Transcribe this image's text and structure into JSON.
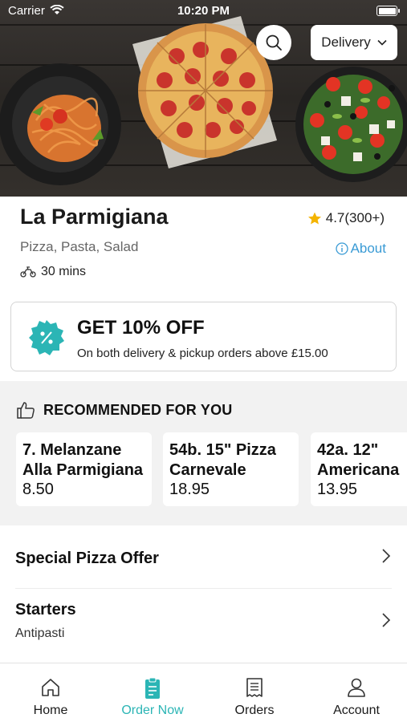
{
  "status_bar": {
    "carrier": "Carrier",
    "time": "10:20 PM"
  },
  "header": {
    "delivery_mode": "Delivery"
  },
  "restaurant": {
    "name": "La Parmigiana",
    "rating": "4.7(300+)",
    "cuisines": "Pizza, Pasta, Salad",
    "about_label": "About",
    "delivery_time": "30 mins"
  },
  "promo": {
    "title": "GET 10% OFF",
    "subtitle": "On both delivery & pickup orders above £15.00"
  },
  "recommended": {
    "heading": "RECOMMENDED FOR YOU",
    "items": [
      {
        "name": "7. Melanzane\nAlla Parmigiana",
        "price": "8.50"
      },
      {
        "name": "54b. 15\" Pizza\nCarnevale",
        "price": "18.95"
      },
      {
        "name": "42a. 12\"\nAmericana",
        "price": "13.95"
      }
    ]
  },
  "menu": [
    {
      "title": "Special Pizza Offer",
      "subtitle": ""
    },
    {
      "title": "Starters",
      "subtitle": "Antipasti"
    }
  ],
  "tabs": [
    {
      "label": "Home",
      "icon": "home-icon"
    },
    {
      "label": "Order Now",
      "icon": "order-icon"
    },
    {
      "label": "Orders",
      "icon": "receipt-icon"
    },
    {
      "label": "Account",
      "icon": "user-icon"
    }
  ],
  "colors": {
    "accent": "#2bb5b5",
    "link": "#3a9bd5",
    "star": "#f4b400",
    "promo_badge": "#2bb5b5"
  }
}
